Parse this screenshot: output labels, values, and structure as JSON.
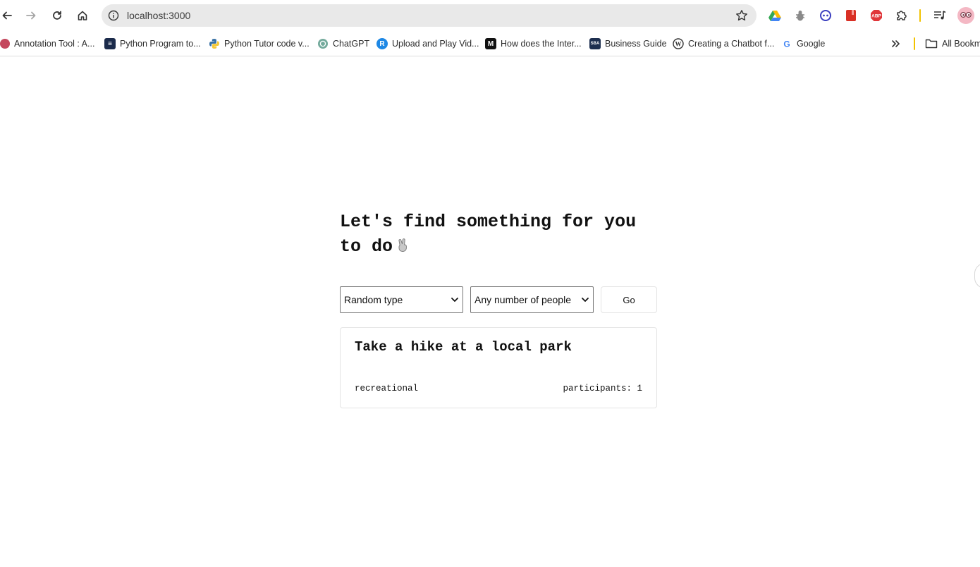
{
  "browser": {
    "url": "localhost:3000",
    "bookmarks": [
      {
        "label": "Annotation Tool : A..."
      },
      {
        "label": "Python Program to..."
      },
      {
        "label": "Python Tutor code v..."
      },
      {
        "label": "ChatGPT"
      },
      {
        "label": "Upload and Play Vid..."
      },
      {
        "label": "How does the Inter..."
      },
      {
        "label": "Business Guide"
      },
      {
        "label": "Creating a Chatbot f..."
      },
      {
        "label": "Google"
      }
    ],
    "all_bookmarks_label": "All Bookm"
  },
  "app": {
    "headline": "Let's find something for you to do",
    "type_select": {
      "selected": "Random type"
    },
    "people_select": {
      "selected": "Any number of people"
    },
    "go_label": "Go",
    "activity": {
      "title": "Take a hike at a local park",
      "type": "recreational",
      "participants": "participants: 1"
    }
  }
}
